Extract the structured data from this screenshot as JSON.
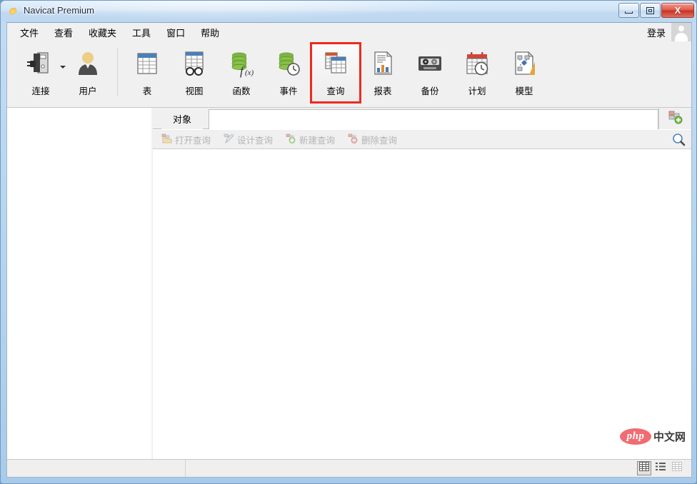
{
  "window": {
    "title": "Navicat Premium",
    "app_icon": "navicat-logo-icon",
    "buttons": {
      "minimize": "minimize-icon",
      "maximize": "maximize-icon",
      "close": "X"
    }
  },
  "menubar": {
    "items": [
      {
        "label": "文件",
        "name": "menu-file"
      },
      {
        "label": "查看",
        "name": "menu-view"
      },
      {
        "label": "收藏夹",
        "name": "menu-favorites"
      },
      {
        "label": "工具",
        "name": "menu-tools"
      },
      {
        "label": "窗口",
        "name": "menu-window"
      },
      {
        "label": "帮助",
        "name": "menu-help"
      }
    ],
    "login_label": "登录",
    "avatar_icon": "user-avatar-icon"
  },
  "toolbar": {
    "highlight_color": "#ee2a1f",
    "items": [
      {
        "label": "连接",
        "icon": "connection-icon",
        "name": "toolbar-connection",
        "has_dropdown": true,
        "highlighted": false
      },
      {
        "label": "用户",
        "icon": "user-icon",
        "name": "toolbar-user",
        "has_dropdown": false,
        "highlighted": false
      },
      {
        "label": "表",
        "icon": "table-icon",
        "name": "toolbar-table",
        "has_dropdown": false,
        "highlighted": false
      },
      {
        "label": "视图",
        "icon": "view-icon",
        "name": "toolbar-view",
        "has_dropdown": false,
        "highlighted": false
      },
      {
        "label": "函数",
        "icon": "function-icon",
        "name": "toolbar-function",
        "has_dropdown": false,
        "highlighted": false
      },
      {
        "label": "事件",
        "icon": "event-icon",
        "name": "toolbar-event",
        "has_dropdown": false,
        "highlighted": false
      },
      {
        "label": "查询",
        "icon": "query-icon",
        "name": "toolbar-query",
        "has_dropdown": false,
        "highlighted": true
      },
      {
        "label": "报表",
        "icon": "report-icon",
        "name": "toolbar-report",
        "has_dropdown": false,
        "highlighted": false
      },
      {
        "label": "备份",
        "icon": "backup-icon",
        "name": "toolbar-backup",
        "has_dropdown": false,
        "highlighted": false
      },
      {
        "label": "计划",
        "icon": "schedule-icon",
        "name": "toolbar-schedule",
        "has_dropdown": false,
        "highlighted": false
      },
      {
        "label": "模型",
        "icon": "model-icon",
        "name": "toolbar-model",
        "has_dropdown": false,
        "highlighted": false
      }
    ]
  },
  "object_panel": {
    "tab_label": "对象",
    "add_tab_icon": "new-object-tab-icon",
    "search_icon": "search-icon",
    "buttons": [
      {
        "label": "打开查询",
        "icon": "open-query-icon",
        "name": "open-query-button",
        "enabled": false
      },
      {
        "label": "设计查询",
        "icon": "design-query-icon",
        "name": "design-query-button",
        "enabled": false
      },
      {
        "label": "新建查询",
        "icon": "new-query-icon",
        "name": "new-query-button",
        "enabled": false
      },
      {
        "label": "删除查询",
        "icon": "delete-query-icon",
        "name": "delete-query-button",
        "enabled": false
      }
    ]
  },
  "sidebar": {
    "items": []
  },
  "statusbar": {
    "left_text": "",
    "right_text": "",
    "view_modes": [
      {
        "name": "view-mode-grid",
        "icon": "grid-view-icon",
        "active": true
      },
      {
        "name": "view-mode-list",
        "icon": "list-view-icon",
        "active": false
      },
      {
        "name": "view-mode-detail",
        "icon": "detail-view-icon",
        "active": false
      }
    ]
  },
  "watermark": {
    "badge": "php",
    "text": "中文网"
  }
}
